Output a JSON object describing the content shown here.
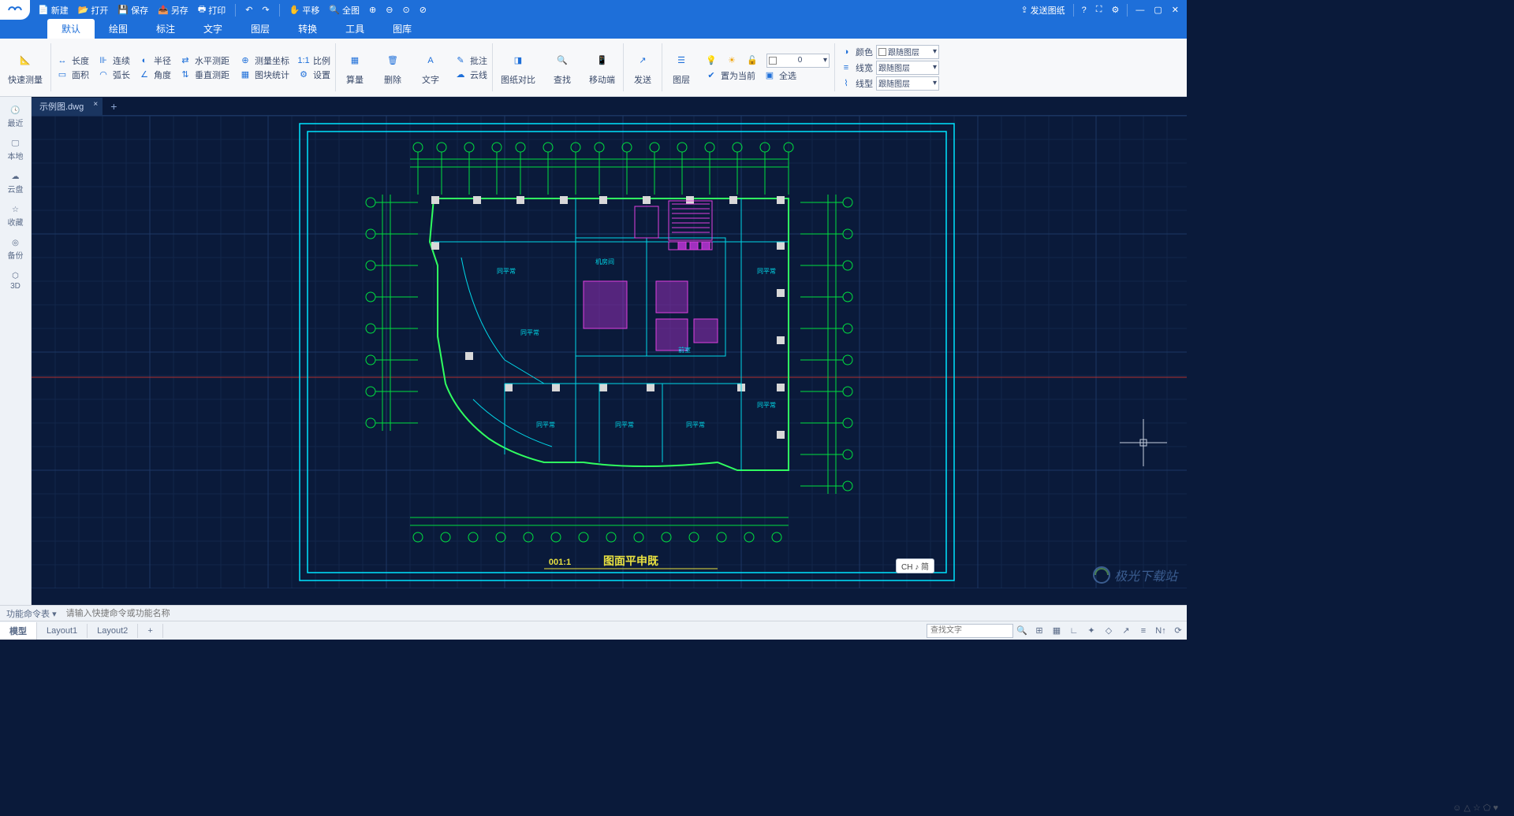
{
  "titlebar": {
    "new": "新建",
    "open": "打开",
    "save": "保存",
    "saveas": "另存",
    "print": "打印",
    "pan": "平移",
    "fit": "全图",
    "send_drawing": "发送图纸"
  },
  "menu": {
    "tabs": [
      "默认",
      "绘图",
      "标注",
      "文字",
      "图层",
      "转换",
      "工具",
      "图库"
    ],
    "active": 0
  },
  "ribbon": {
    "quick_measure": "快速测量",
    "length": "长度",
    "continuous": "连续",
    "radius": "半径",
    "h_dist": "水平测距",
    "area": "面积",
    "arc": "弧长",
    "angle": "角度",
    "v_dist": "垂直测距",
    "coord": "测量坐标",
    "scale": "比例",
    "block_stat": "图块统计",
    "settings": "设置",
    "table": "算量",
    "delete": "删除",
    "text": "文字",
    "annotate": "批注",
    "cloud": "云线",
    "compare": "图纸对比",
    "find": "查找",
    "mobile": "移动端",
    "send": "发送",
    "layer": "图层",
    "set_current": "置为当前",
    "select_all": "全选",
    "layer_val": "0",
    "props": {
      "color": "颜色",
      "color_val": "跟随图层",
      "lw": "线宽",
      "lw_val": "跟随图层",
      "lt": "线型",
      "lt_val": "跟随图层"
    }
  },
  "sidebar": {
    "items": [
      {
        "label": "最近",
        "icon": "clock"
      },
      {
        "label": "本地",
        "icon": "monitor"
      },
      {
        "label": "云盘",
        "icon": "cloud"
      },
      {
        "label": "收藏",
        "icon": "star"
      },
      {
        "label": "备份",
        "icon": "disk"
      },
      {
        "label": "3D",
        "icon": "cube"
      }
    ]
  },
  "doc": {
    "filename": "示例图.dwg"
  },
  "canvas": {
    "title_text": "图面平申既",
    "scale_text": "001:1",
    "rooms": [
      "机房间",
      "同平常",
      "同平常",
      "同平常",
      "同平常",
      "同平常",
      "前室",
      "同平常"
    ]
  },
  "cmdbar": {
    "label": "功能命令表",
    "placeholder": "请输入快捷命令或功能名称"
  },
  "status": {
    "layouts": [
      "模型",
      "Layout1",
      "Layout2"
    ],
    "active_layout": 0,
    "search_placeholder": "查找文字",
    "ime": "CH ♪ 简"
  },
  "watermark": "极光下载站"
}
